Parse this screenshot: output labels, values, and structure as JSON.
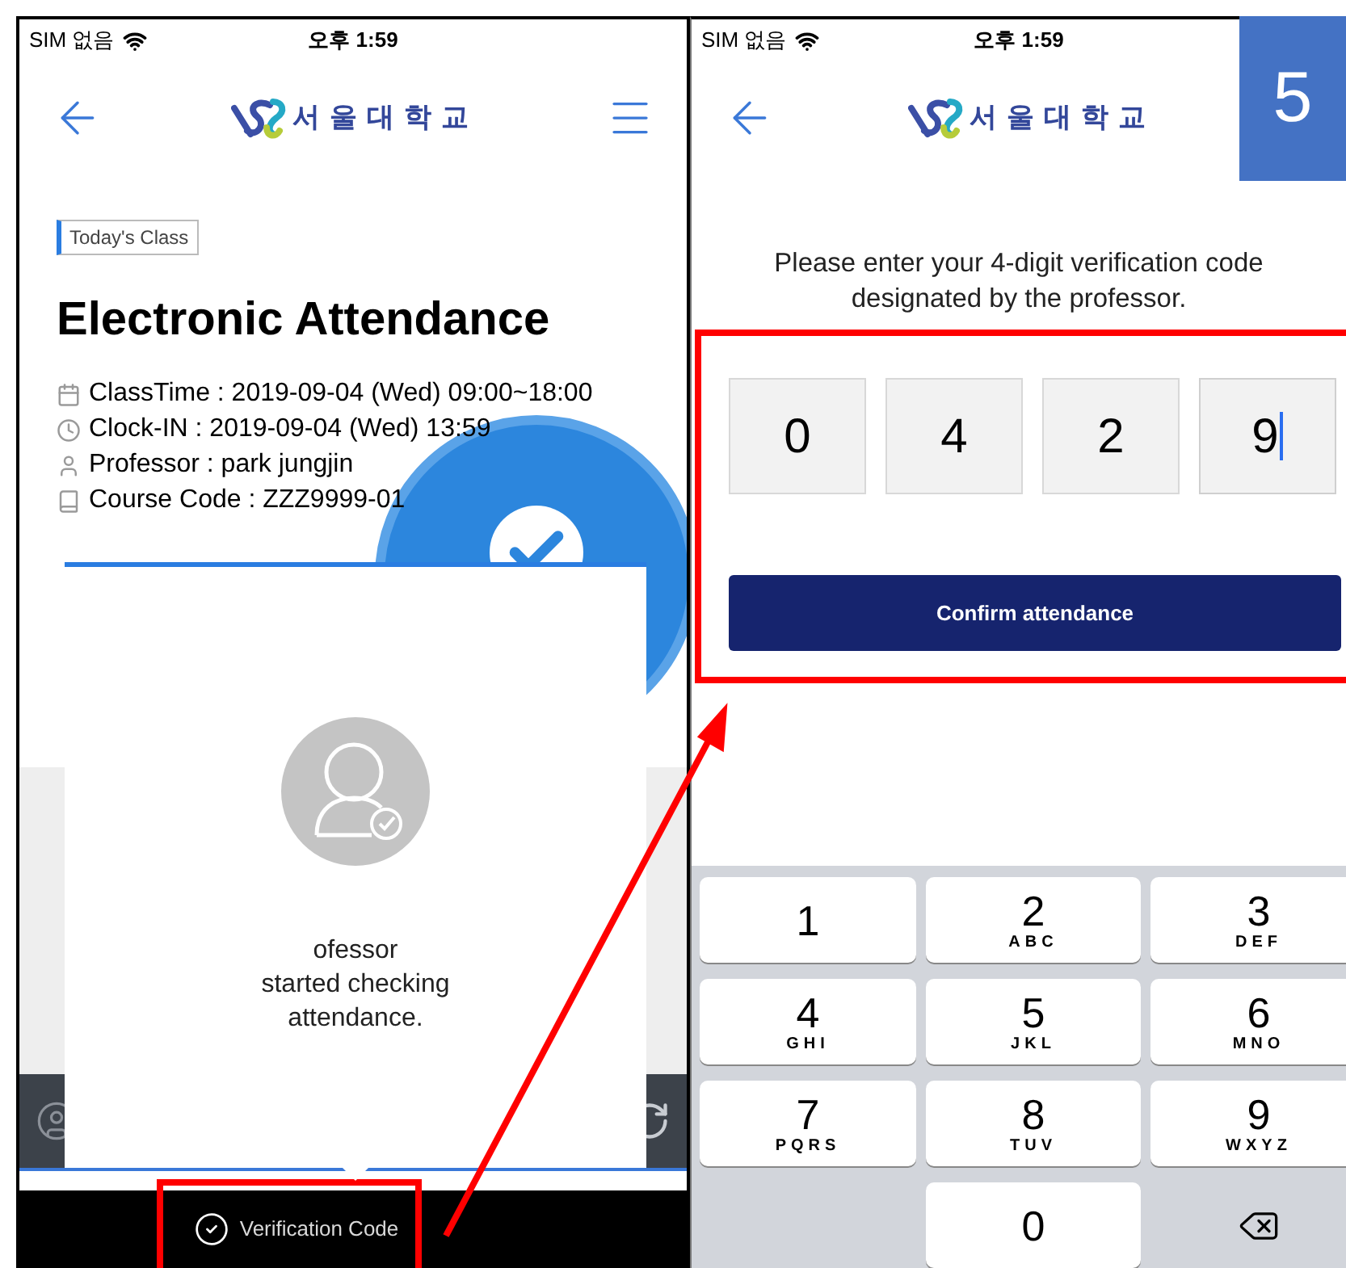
{
  "left_screen": {
    "status_bar": {
      "carrier": "SIM 없음",
      "time": "오후 1:59"
    },
    "header": {
      "logo_text": "서울대학교"
    },
    "tag": "Today's Class",
    "title": "Electronic Attendance",
    "details": [
      {
        "kind": "calendar",
        "text": "ClassTime : 2019-09-04 (Wed) 09:00~18:00"
      },
      {
        "kind": "clock",
        "text": "Clock-IN : 2019-09-04 (Wed) 13:59"
      },
      {
        "kind": "person",
        "text": "Professor : park jungjin"
      },
      {
        "kind": "book",
        "text": "Course Code : ZZZ9999-01"
      }
    ],
    "popup": {
      "message": "ofessor\nstarted checking\nattendance."
    },
    "bottom_bar": {
      "label": "Verification Code"
    }
  },
  "right_screen": {
    "status_bar": {
      "carrier": "SIM 없음",
      "time": "오후 1:59"
    },
    "header": {
      "logo_text": "서울대학교"
    },
    "instruction": "Please enter your 4-digit verification code designated by the professor.",
    "code_digits": [
      {
        "value": "0",
        "focused": false
      },
      {
        "value": "4",
        "focused": false
      },
      {
        "value": "2",
        "focused": false
      },
      {
        "value": "9",
        "focused": true
      }
    ],
    "confirm_button": "Confirm attendance",
    "keypad": [
      {
        "kind": "key",
        "digit": "1"
      },
      {
        "kind": "key",
        "digit": "2",
        "letters": "ABC"
      },
      {
        "kind": "key",
        "digit": "3",
        "letters": "DEF"
      },
      {
        "kind": "key",
        "digit": "4",
        "letters": "GHI"
      },
      {
        "kind": "key",
        "digit": "5",
        "letters": "JKL"
      },
      {
        "kind": "key",
        "digit": "6",
        "letters": "MNO"
      },
      {
        "kind": "key",
        "digit": "7",
        "letters": "PQRS"
      },
      {
        "kind": "key",
        "digit": "8",
        "letters": "TUV"
      },
      {
        "kind": "key",
        "digit": "9",
        "letters": "WXYZ"
      },
      {
        "kind": "blank"
      },
      {
        "kind": "key",
        "digit": "0"
      },
      {
        "kind": "delete"
      }
    ]
  },
  "step_badge": "5"
}
